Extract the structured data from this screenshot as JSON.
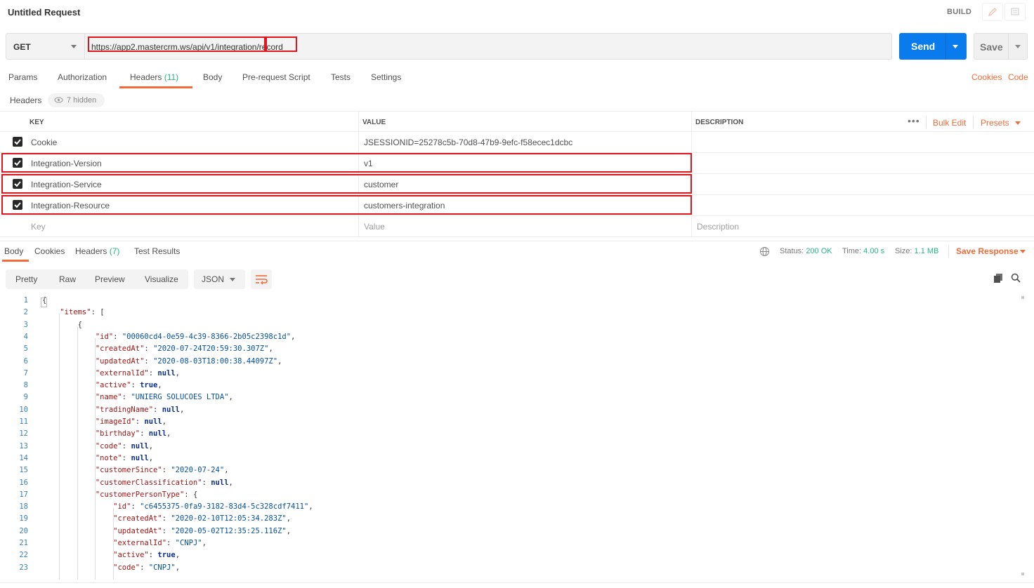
{
  "window": {
    "title": "Untitled Request",
    "mode": "BUILD"
  },
  "request": {
    "method": "GET",
    "url": "https://app2.mastercrm.ws/api/v1/integration/record",
    "send_label": "Send",
    "save_label": "Save"
  },
  "request_tabs": [
    {
      "label": "Params"
    },
    {
      "label": "Authorization"
    },
    {
      "label": "Headers",
      "count": "(11)"
    },
    {
      "label": "Body"
    },
    {
      "label": "Pre-request Script"
    },
    {
      "label": "Tests"
    },
    {
      "label": "Settings"
    }
  ],
  "request_links": {
    "cookies": "Cookies",
    "code": "Code"
  },
  "headers_bar": {
    "label": "Headers",
    "hidden": "7 hidden"
  },
  "headers_table": {
    "columns": {
      "key": "KEY",
      "value": "VALUE",
      "description": "DESCRIPTION"
    },
    "dots": "•••",
    "bulk_edit": "Bulk Edit",
    "presets": "Presets",
    "rows": [
      {
        "key": "Cookie",
        "value": "JSESSIONID=25278c5b-70d8-47b9-9efc-f58ecec1dcbc",
        "checked": true
      },
      {
        "key": "Integration-Version",
        "value": "v1",
        "checked": true
      },
      {
        "key": "Integration-Service",
        "value": "customer",
        "checked": true
      },
      {
        "key": "Integration-Resource",
        "value": "customers-integration",
        "checked": true
      }
    ],
    "placeholders": {
      "key": "Key",
      "value": "Value",
      "description": "Description"
    }
  },
  "response_tabs": [
    {
      "label": "Body"
    },
    {
      "label": "Cookies"
    },
    {
      "label": "Headers",
      "count": "(7)"
    },
    {
      "label": "Test Results"
    }
  ],
  "response_status": {
    "status_label": "Status:",
    "status": "200 OK",
    "time_label": "Time:",
    "time": "4.00 s",
    "size_label": "Size:",
    "size": "1.1 MB",
    "save_response": "Save Response"
  },
  "format_tabs": [
    "Pretty",
    "Raw",
    "Preview",
    "Visualize"
  ],
  "format_select": "JSON",
  "colors": {
    "accent": "#f26b3a",
    "send": "#097bed",
    "success": "#26b47f",
    "highlight": "#e0141b"
  },
  "code_lines": [
    [
      [
        "p",
        "{"
      ]
    ],
    [
      [
        "p",
        "    "
      ],
      [
        "k",
        "\"items\""
      ],
      [
        "p",
        ": ["
      ]
    ],
    [
      [
        "p",
        "        {"
      ]
    ],
    [
      [
        "p",
        "            "
      ],
      [
        "k",
        "\"id\""
      ],
      [
        "p",
        ": "
      ],
      [
        "s",
        "\"00060cd4-0e59-4c39-8366-2b05c2398c1d\""
      ],
      [
        "p",
        ","
      ]
    ],
    [
      [
        "p",
        "            "
      ],
      [
        "k",
        "\"createdAt\""
      ],
      [
        "p",
        ": "
      ],
      [
        "s",
        "\"2020-07-24T20:59:30.307Z\""
      ],
      [
        "p",
        ","
      ]
    ],
    [
      [
        "p",
        "            "
      ],
      [
        "k",
        "\"updatedAt\""
      ],
      [
        "p",
        ": "
      ],
      [
        "s",
        "\"2020-08-03T18:00:38.44097Z\""
      ],
      [
        "p",
        ","
      ]
    ],
    [
      [
        "p",
        "            "
      ],
      [
        "k",
        "\"externalId\""
      ],
      [
        "p",
        ": "
      ],
      [
        "b",
        "null"
      ],
      [
        "p",
        ","
      ]
    ],
    [
      [
        "p",
        "            "
      ],
      [
        "k",
        "\"active\""
      ],
      [
        "p",
        ": "
      ],
      [
        "b",
        "true"
      ],
      [
        "p",
        ","
      ]
    ],
    [
      [
        "p",
        "            "
      ],
      [
        "k",
        "\"name\""
      ],
      [
        "p",
        ": "
      ],
      [
        "s",
        "\"UNIERG SOLUCOES LTDA\""
      ],
      [
        "p",
        ","
      ]
    ],
    [
      [
        "p",
        "            "
      ],
      [
        "k",
        "\"tradingName\""
      ],
      [
        "p",
        ": "
      ],
      [
        "b",
        "null"
      ],
      [
        "p",
        ","
      ]
    ],
    [
      [
        "p",
        "            "
      ],
      [
        "k",
        "\"imageId\""
      ],
      [
        "p",
        ": "
      ],
      [
        "b",
        "null"
      ],
      [
        "p",
        ","
      ]
    ],
    [
      [
        "p",
        "            "
      ],
      [
        "k",
        "\"birthday\""
      ],
      [
        "p",
        ": "
      ],
      [
        "b",
        "null"
      ],
      [
        "p",
        ","
      ]
    ],
    [
      [
        "p",
        "            "
      ],
      [
        "k",
        "\"code\""
      ],
      [
        "p",
        ": "
      ],
      [
        "b",
        "null"
      ],
      [
        "p",
        ","
      ]
    ],
    [
      [
        "p",
        "            "
      ],
      [
        "k",
        "\"note\""
      ],
      [
        "p",
        ": "
      ],
      [
        "b",
        "null"
      ],
      [
        "p",
        ","
      ]
    ],
    [
      [
        "p",
        "            "
      ],
      [
        "k",
        "\"customerSince\""
      ],
      [
        "p",
        ": "
      ],
      [
        "s",
        "\"2020-07-24\""
      ],
      [
        "p",
        ","
      ]
    ],
    [
      [
        "p",
        "            "
      ],
      [
        "k",
        "\"customerClassification\""
      ],
      [
        "p",
        ": "
      ],
      [
        "b",
        "null"
      ],
      [
        "p",
        ","
      ]
    ],
    [
      [
        "p",
        "            "
      ],
      [
        "k",
        "\"customerPersonType\""
      ],
      [
        "p",
        ": {"
      ]
    ],
    [
      [
        "p",
        "                "
      ],
      [
        "k",
        "\"id\""
      ],
      [
        "p",
        ": "
      ],
      [
        "s",
        "\"c6455375-0fa9-3182-83d4-5c328cdf7411\""
      ],
      [
        "p",
        ","
      ]
    ],
    [
      [
        "p",
        "                "
      ],
      [
        "k",
        "\"createdAt\""
      ],
      [
        "p",
        ": "
      ],
      [
        "s",
        "\"2020-02-10T12:05:34.283Z\""
      ],
      [
        "p",
        ","
      ]
    ],
    [
      [
        "p",
        "                "
      ],
      [
        "k",
        "\"updatedAt\""
      ],
      [
        "p",
        ": "
      ],
      [
        "s",
        "\"2020-05-02T12:35:25.116Z\""
      ],
      [
        "p",
        ","
      ]
    ],
    [
      [
        "p",
        "                "
      ],
      [
        "k",
        "\"externalId\""
      ],
      [
        "p",
        ": "
      ],
      [
        "s",
        "\"CNPJ\""
      ],
      [
        "p",
        ","
      ]
    ],
    [
      [
        "p",
        "                "
      ],
      [
        "k",
        "\"active\""
      ],
      [
        "p",
        ": "
      ],
      [
        "b",
        "true"
      ],
      [
        "p",
        ","
      ]
    ],
    [
      [
        "p",
        "                "
      ],
      [
        "k",
        "\"code\""
      ],
      [
        "p",
        ": "
      ],
      [
        "s",
        "\"CNPJ\""
      ],
      [
        "p",
        ","
      ]
    ]
  ],
  "code_line_numbers": [
    "1",
    "2",
    "3",
    "4",
    "5",
    "6",
    "7",
    "8",
    "9",
    "10",
    "11",
    "12",
    "13",
    "14",
    "15",
    "16",
    "17",
    "18",
    "19",
    "20",
    "21",
    "22",
    "23"
  ]
}
